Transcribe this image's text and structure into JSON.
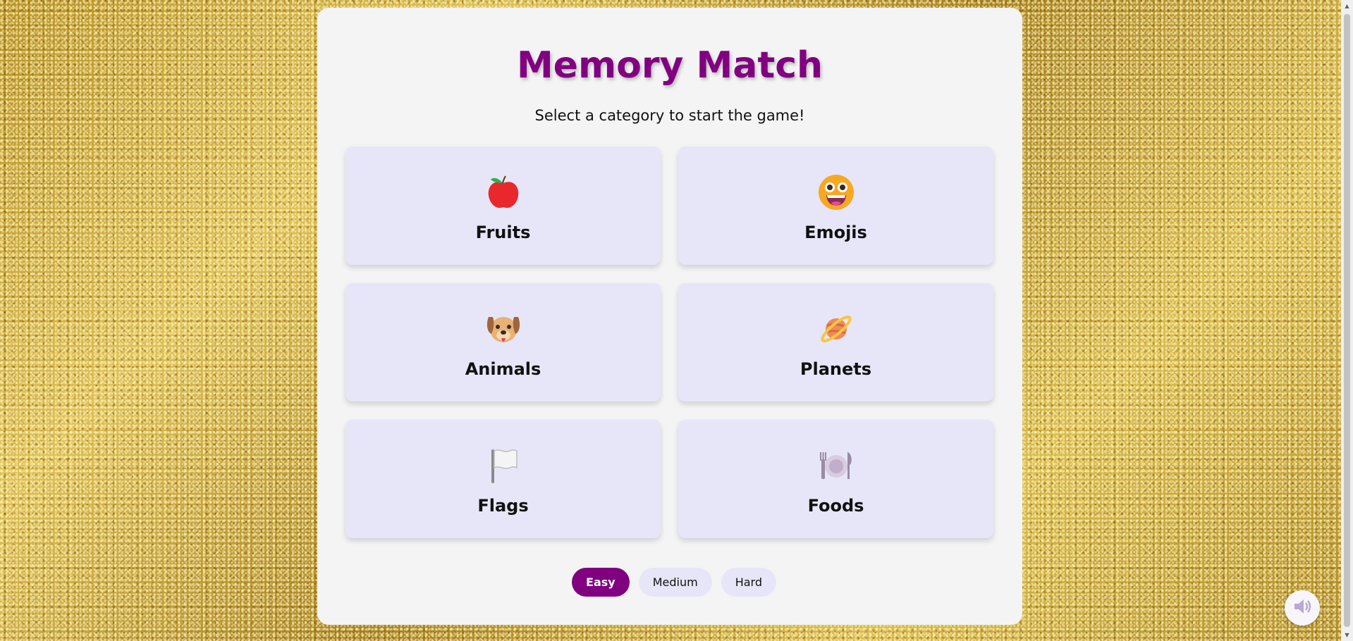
{
  "game": {
    "title": "Memory Match",
    "subtitle": "Select a category to start the game!"
  },
  "categories": [
    {
      "label": "Fruits",
      "icon": "apple-icon"
    },
    {
      "label": "Emojis",
      "icon": "grinning-face-icon"
    },
    {
      "label": "Animals",
      "icon": "dog-face-icon"
    },
    {
      "label": "Planets",
      "icon": "ringed-planet-icon"
    },
    {
      "label": "Flags",
      "icon": "white-flag-icon"
    },
    {
      "label": "Foods",
      "icon": "plate-with-cutlery-icon"
    }
  ],
  "difficulty": {
    "options": [
      "Easy",
      "Medium",
      "Hard"
    ],
    "selected": "Easy"
  },
  "sound": {
    "icon": "speaker-icon"
  },
  "colors": {
    "title": "#800080",
    "active_button": "#800080",
    "card_background": "#e6e6f8",
    "panel_background": "#f4f4f5",
    "page_background": "#c9a227"
  }
}
